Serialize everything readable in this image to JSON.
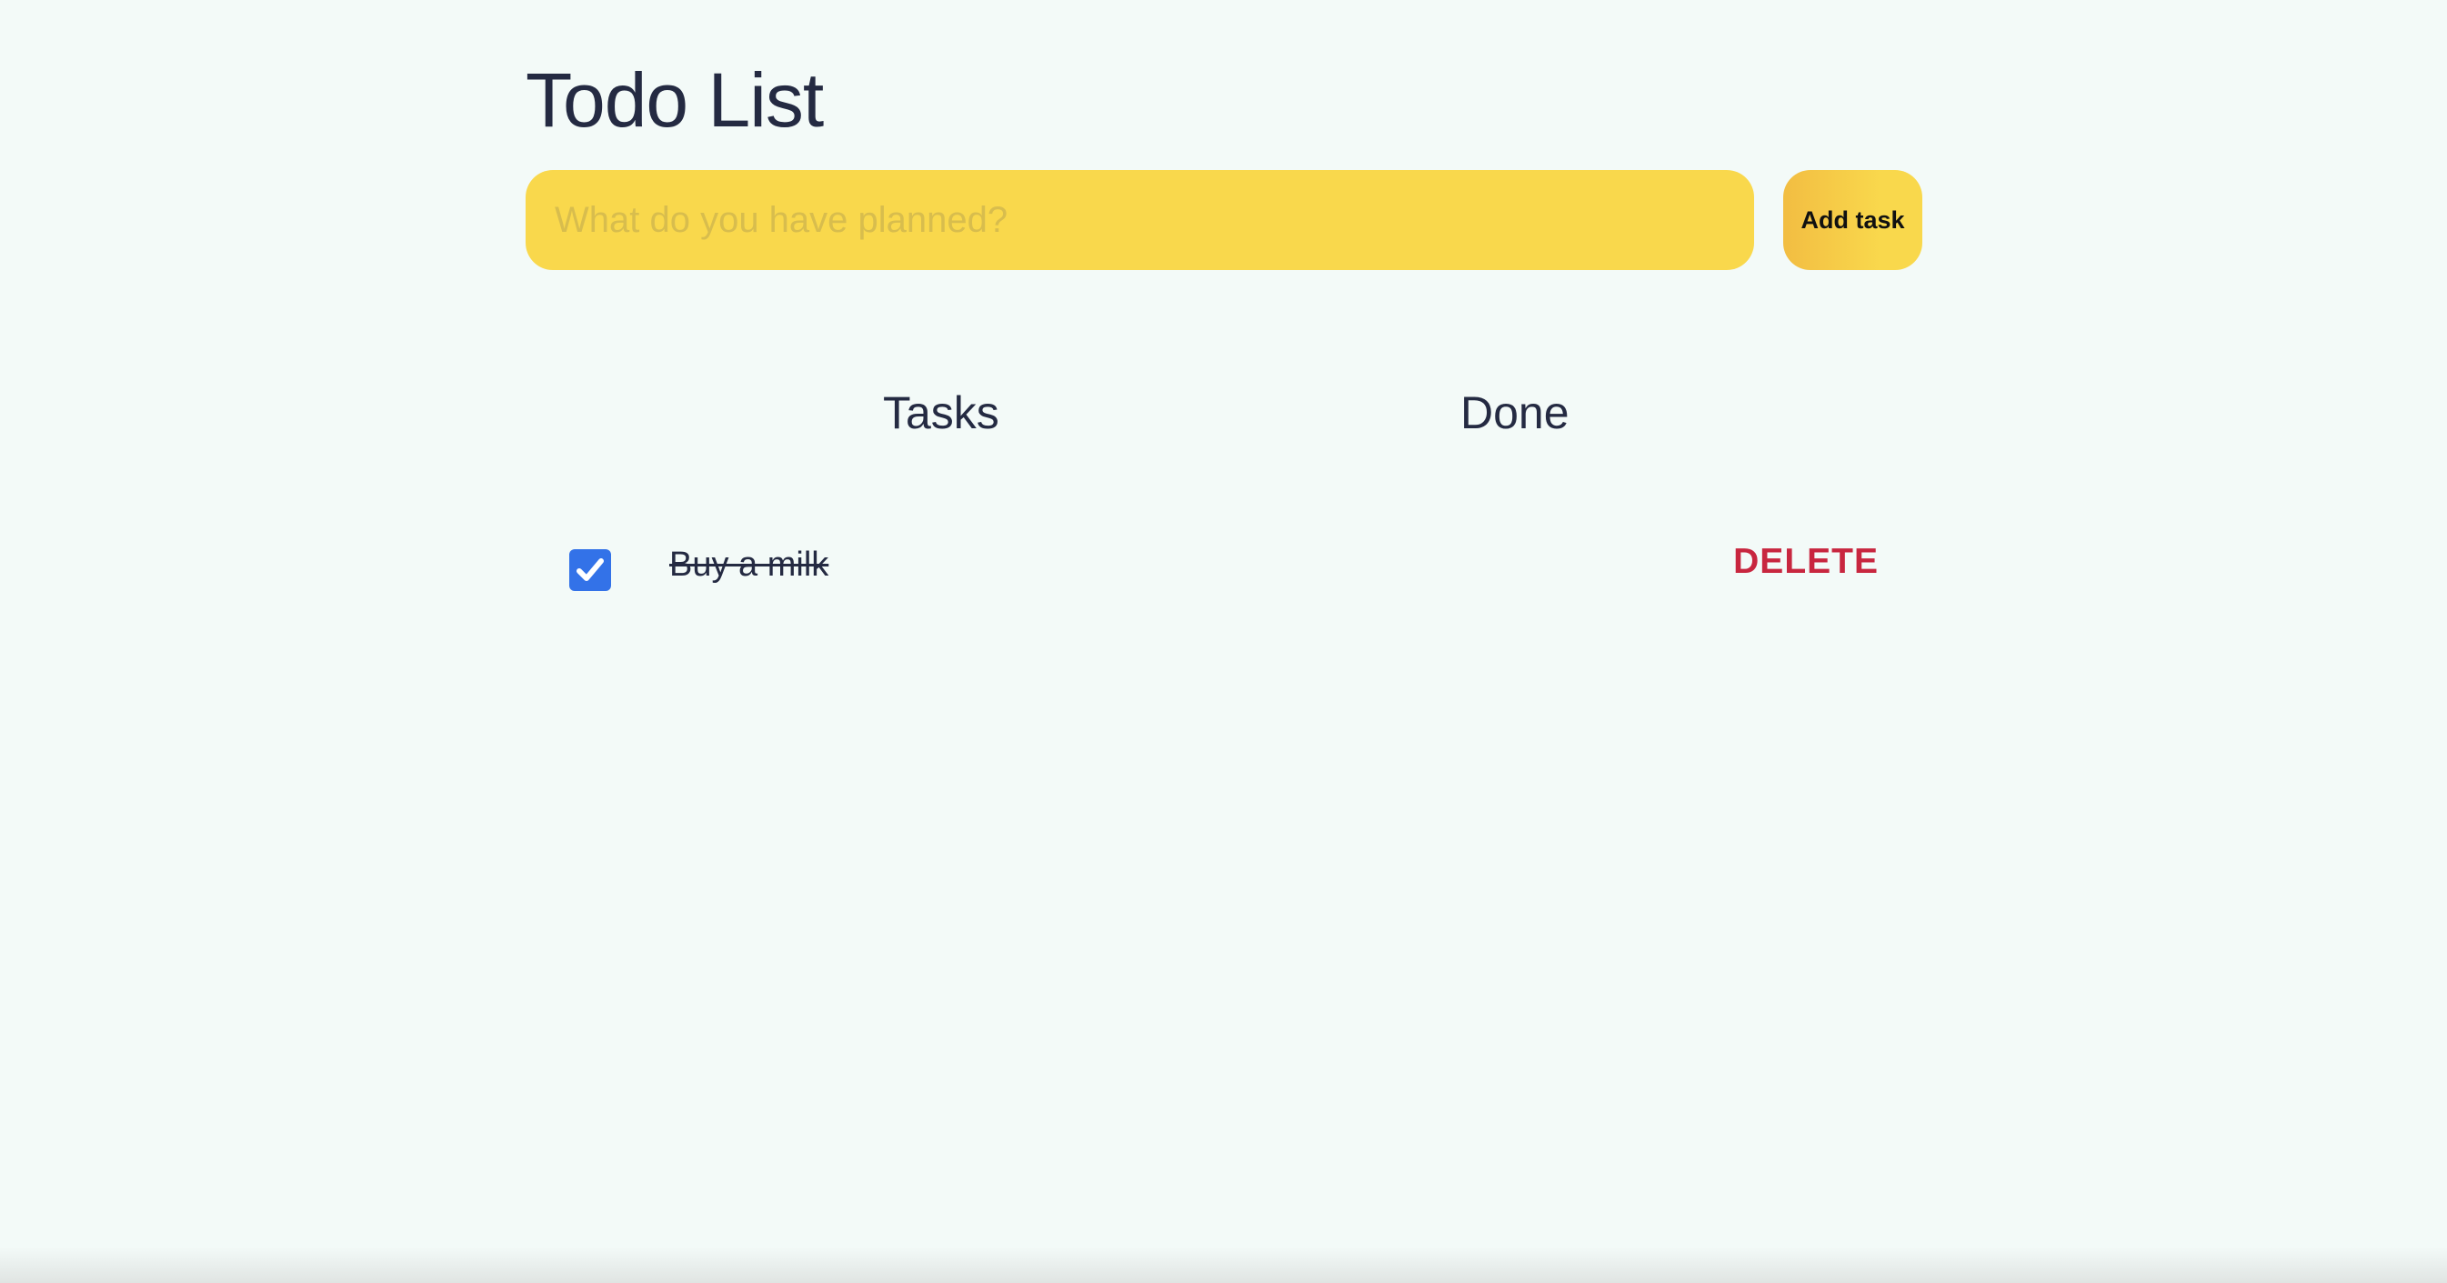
{
  "app": {
    "title": "Todo List"
  },
  "new_task": {
    "placeholder": "What do you have planned?",
    "value": "",
    "add_label": "Add task"
  },
  "columns": {
    "tasks_label": "Tasks",
    "done_label": "Done"
  },
  "tasks": [
    {
      "text": "Buy a milk",
      "checked": true,
      "delete_label": "DELETE"
    }
  ],
  "colors": {
    "background": "#f3faf8",
    "input_bg": "#f9d84c",
    "checkbox": "#3372e8",
    "delete": "#c8263f",
    "text": "#242a42"
  },
  "icons": {
    "checkbox_checked": "check-icon"
  }
}
